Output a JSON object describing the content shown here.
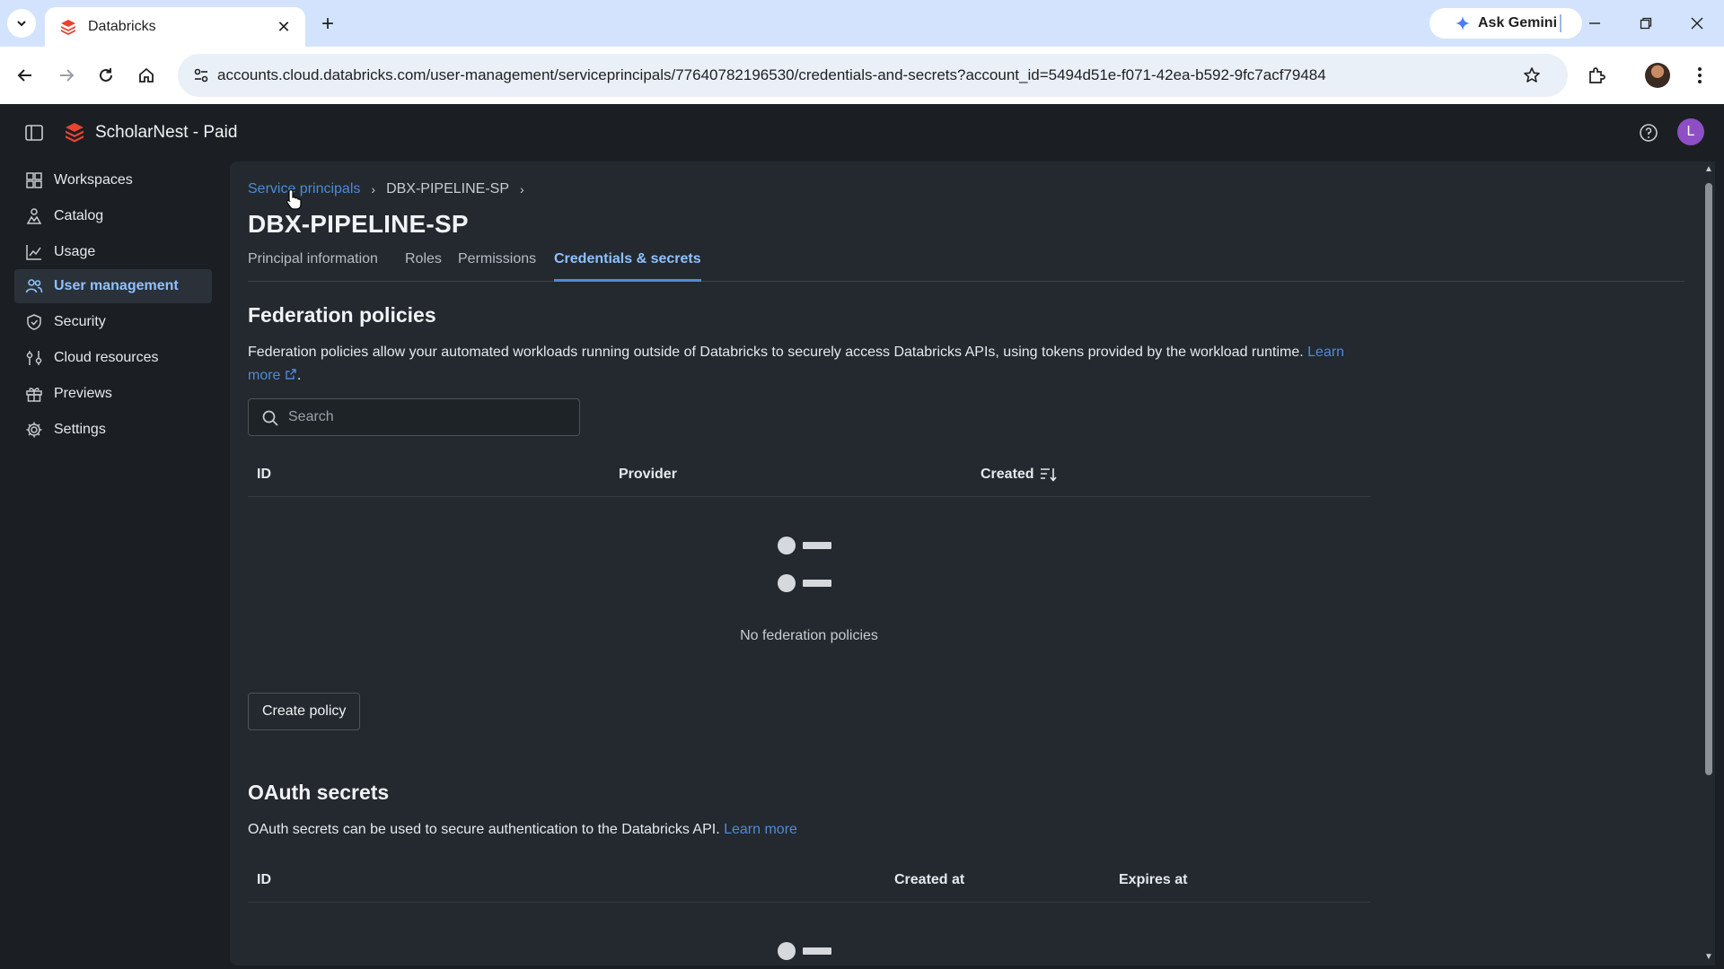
{
  "browser": {
    "tab_title": "Databricks",
    "tab_close": "✕",
    "new_tab": "+",
    "ask_gemini": "Ask Gemini",
    "url": "accounts.cloud.databricks.com/user-management/serviceprincipals/77640782196530/credentials-and-secrets?account_id=5494d51e-f071-42ea-b592-9fc7acf79484"
  },
  "header": {
    "workspace_name": "ScholarNest - Paid",
    "avatar_letter": "L"
  },
  "sidebar": {
    "items": [
      {
        "label": "Workspaces",
        "icon": "workspaces-icon"
      },
      {
        "label": "Catalog",
        "icon": "catalog-icon"
      },
      {
        "label": "Usage",
        "icon": "usage-chart-icon"
      },
      {
        "label": "User management",
        "icon": "users-icon",
        "active": true
      },
      {
        "label": "Security",
        "icon": "shield-icon"
      },
      {
        "label": "Cloud resources",
        "icon": "cloud-resources-icon"
      },
      {
        "label": "Previews",
        "icon": "gift-icon"
      },
      {
        "label": "Settings",
        "icon": "gear-icon"
      }
    ]
  },
  "breadcrumb": {
    "parent": "Service principals",
    "current": "DBX-PIPELINE-SP",
    "separator": "›"
  },
  "page": {
    "title": "DBX-PIPELINE-SP",
    "tabs": [
      "Principal information",
      "Roles",
      "Permissions",
      "Credentials & secrets"
    ],
    "active_tab": "Credentials & secrets"
  },
  "federation": {
    "title": "Federation policies",
    "description": "Federation policies allow your automated workloads running outside of Databricks to securely access Databricks APIs, using tokens provided by the workload runtime.",
    "learn_more": "Learn more",
    "period": ".",
    "search_placeholder": "Search",
    "columns": [
      "ID",
      "Provider",
      "Created"
    ],
    "empty_text": "No federation policies",
    "create_button": "Create policy"
  },
  "oauth": {
    "title": "OAuth secrets",
    "description": "OAuth secrets can be used to secure authentication to the Databricks API.",
    "learn_more": "Learn more",
    "columns": [
      "ID",
      "Created at",
      "Expires at"
    ]
  },
  "colors": {
    "accent": "#4e8ad6",
    "active_tab": "#8fc1ff",
    "background": "#1b1f23",
    "panel": "#23292f",
    "avatar": "#8e4ec6"
  }
}
